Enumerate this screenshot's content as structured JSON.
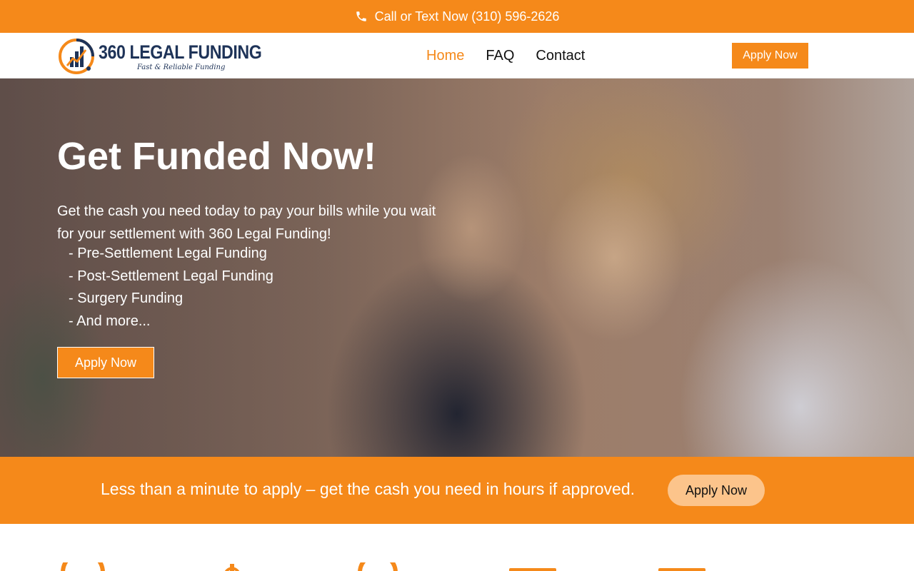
{
  "topbar": {
    "text": "Call or Text Now (310) 596-2626",
    "icon": "phone-icon"
  },
  "brand": {
    "name": "360 LEGAL FUNDING",
    "tagline": "Fast & Reliable Funding",
    "navy": "#1e3358"
  },
  "nav": {
    "items": [
      {
        "label": "Home",
        "active": true
      },
      {
        "label": "FAQ",
        "active": false
      },
      {
        "label": "Contact",
        "active": false
      }
    ],
    "apply_label": "Apply Now"
  },
  "hero": {
    "title": "Get Funded Now!",
    "description": "Get the cash you need today to pay your bills while you wait for your settlement with 360 Legal Funding!",
    "list": [
      "- Pre-Settlement Legal Funding",
      "- Post-Settlement Legal Funding",
      "- Surgery Funding",
      "- And more..."
    ],
    "apply_label": "Apply Now"
  },
  "band": {
    "text": "Less than a minute to apply – get the cash you need in hours if approved.",
    "apply_label": "Apply Now"
  },
  "features": {
    "icons": [
      "clock-icon",
      "dollar-icon",
      "clock-icon",
      "calendar-icon",
      "calendar-icon"
    ]
  },
  "colors": {
    "accent": "#f5891a",
    "accent_light": "#fcc48b"
  }
}
